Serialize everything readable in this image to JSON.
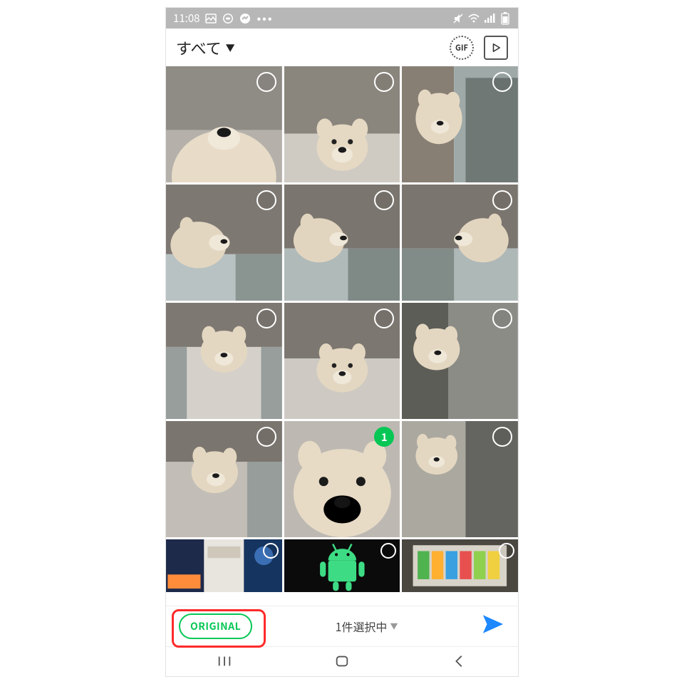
{
  "status": {
    "time": "11:08",
    "tray_more": "•••"
  },
  "appbar": {
    "album_label": "すべて",
    "gif_label": "GIF"
  },
  "grid": {
    "tiles": [
      {
        "selected": false
      },
      {
        "selected": false
      },
      {
        "selected": false
      },
      {
        "selected": false
      },
      {
        "selected": false
      },
      {
        "selected": false
      },
      {
        "selected": false
      },
      {
        "selected": false
      },
      {
        "selected": false
      },
      {
        "selected": false
      },
      {
        "selected": true,
        "badge": "1"
      },
      {
        "selected": false
      },
      {
        "selected": false
      },
      {
        "selected": false
      },
      {
        "selected": false
      }
    ]
  },
  "bottom": {
    "original_label": "ORIGINAL",
    "selection_text": "1件選択中"
  },
  "colors": {
    "accent_green": "#06c755",
    "send_blue": "#1e88ff",
    "highlight_red": "#ff2a2a"
  }
}
